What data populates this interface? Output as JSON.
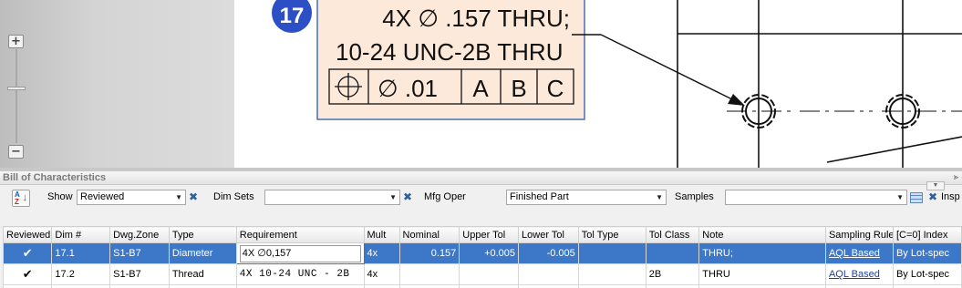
{
  "balloon": {
    "number": "17",
    "color": "#2c4fc6"
  },
  "callout": {
    "line1": "4X  ∅ .157 THRU;",
    "line2": "10-24 UNC-2B THRU",
    "fcf": [
      "∅ .01",
      "A",
      "B",
      "C"
    ],
    "fill": "#fde9d9"
  },
  "panel": {
    "title": "Bill of Characteristics"
  },
  "toolbar": {
    "show_label": "Show",
    "show_value": "Reviewed",
    "dim_sets_label": "Dim Sets",
    "dim_sets_value": "",
    "mfg_oper_label": "Mfg Oper",
    "mfg_oper_value": "Finished Part",
    "samples_label": "Samples",
    "samples_value": "",
    "insp_pro_label": "Insp Pro"
  },
  "table": {
    "columns": [
      "Reviewed",
      "Dim #",
      "Dwg.Zone",
      "Type",
      "Requirement",
      "Mult",
      "Nominal",
      "Upper Tol",
      "Lower Tol",
      "Tol Type",
      "Tol Class",
      "Note",
      "Sampling Rule",
      "[C=0] Index"
    ],
    "rows": [
      {
        "reviewed": "✔",
        "dim": "17.1",
        "zone": "S1-B7",
        "type": "Diameter",
        "requirement": "4X  ∅0,157",
        "mult": "4x",
        "nominal": "0.157",
        "upper_tol": "+0.005",
        "lower_tol": "-0.005",
        "tol_type": "",
        "tol_class": "",
        "note": "THRU;",
        "sampling_rule": "AQL Based",
        "index": "By Lot-spec"
      },
      {
        "reviewed": "✔",
        "dim": "17.2",
        "zone": "S1-B7",
        "type": "Thread",
        "requirement": "4X  10-24  UNC  -  2B",
        "mult": "4x",
        "nominal": "",
        "upper_tol": "",
        "lower_tol": "",
        "tol_type": "",
        "tol_class": "2B",
        "note": "THRU",
        "sampling_rule": "AQL Based",
        "index": "By Lot-spec"
      }
    ]
  },
  "colors": {
    "selection": "#3c78c7",
    "link": "#1a3fa8"
  }
}
